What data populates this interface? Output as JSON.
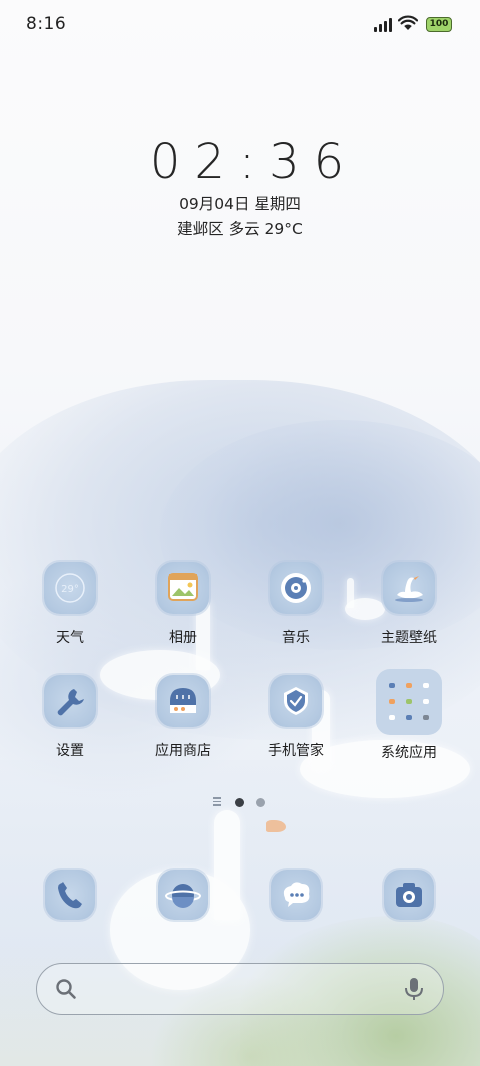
{
  "status_bar": {
    "time": "8:16",
    "battery": "100",
    "icons": [
      "cellular-signal-icon",
      "wifi-icon",
      "battery-icon"
    ]
  },
  "clock_widget": {
    "time": "02:36",
    "date": "09月04日 星期四",
    "weather": "建邺区 多云 29°C"
  },
  "apps": [
    {
      "label": "天气",
      "icon": "weather-icon",
      "badge": "29°"
    },
    {
      "label": "相册",
      "icon": "gallery-icon"
    },
    {
      "label": "音乐",
      "icon": "music-icon"
    },
    {
      "label": "主题壁纸",
      "icon": "theme-wallpaper-icon"
    },
    {
      "label": "设置",
      "icon": "settings-icon"
    },
    {
      "label": "应用商店",
      "icon": "app-store-icon"
    },
    {
      "label": "手机管家",
      "icon": "phone-manager-icon"
    },
    {
      "label": "系统应用",
      "icon": "system-apps-folder-icon"
    }
  ],
  "page_indicator": {
    "pages": 2,
    "current": 1
  },
  "dock": [
    {
      "icon": "phone-icon"
    },
    {
      "icon": "browser-icon"
    },
    {
      "icon": "messages-icon"
    },
    {
      "icon": "camera-icon"
    }
  ],
  "search_bar": {
    "placeholder": "",
    "icons": [
      "search-icon",
      "microphone-icon"
    ]
  },
  "colors": {
    "icon_bg": "#b4c9e1",
    "icon_glyph": "#4f72a8",
    "text": "#1e1e1e"
  }
}
